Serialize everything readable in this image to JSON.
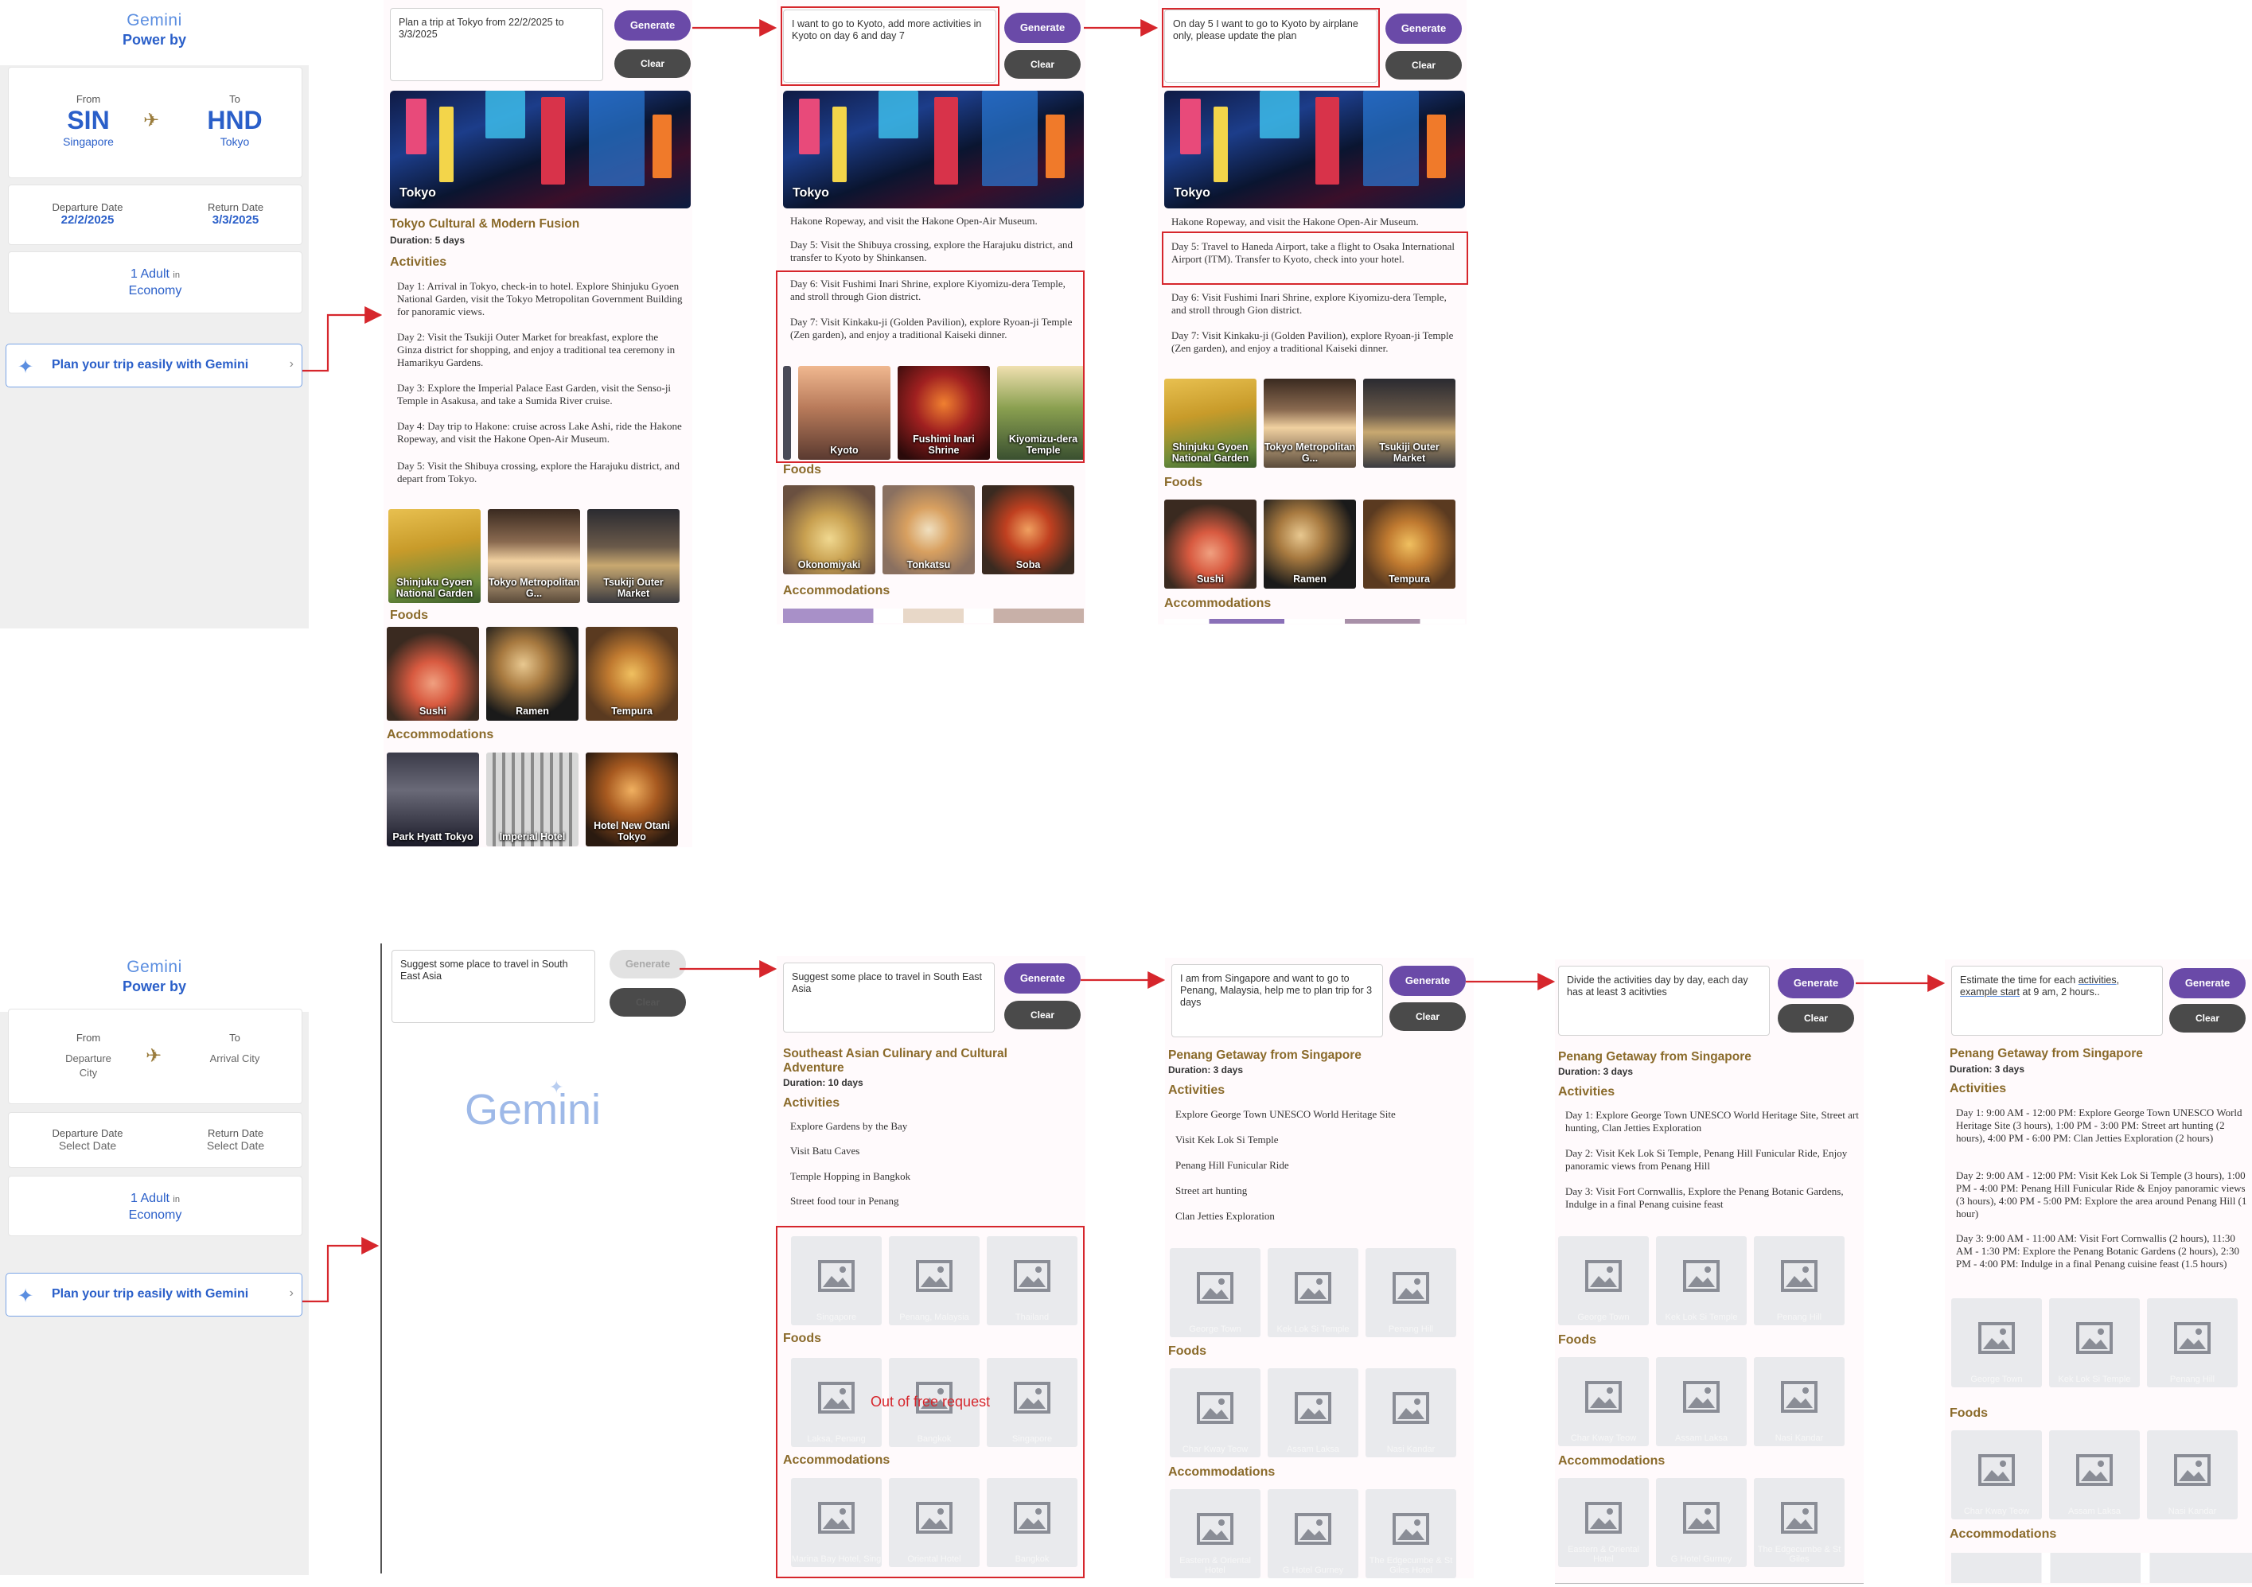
{
  "panel": {
    "logo": "Gemini",
    "powered": "Power by",
    "from_label": "From",
    "to_label": "To",
    "top": {
      "from_code": "SIN",
      "from_city": "Singapore",
      "to_code": "HND",
      "to_city": "Tokyo",
      "departure_label": "Departure Date",
      "departure_value": "22/2/2025",
      "return_label": "Return Date",
      "return_value": "3/3/2025"
    },
    "bottom": {
      "from_city": "Departure City",
      "to_city": "Arrival City",
      "departure_label": "Departure Date",
      "departure_value": "Select Date",
      "return_label": "Return Date",
      "return_value": "Select Date"
    },
    "pax_count": "1 Adult",
    "pax_in": "in",
    "pax_class": "Economy",
    "plan_label": "Plan your trip easily with Gemini",
    "chevron": "›"
  },
  "buttons": {
    "generate": "Generate",
    "clear": "Clear"
  },
  "icons": {
    "plane": "✈",
    "gemini": "✦"
  },
  "sections": {
    "activities": "Activities",
    "foods": "Foods",
    "accommodations": "Accommodations"
  },
  "top": {
    "s1": {
      "prompt": "Plan a trip at Tokyo from 22/2/2025 to 3/3/2025",
      "hero_caption": "Tokyo",
      "title": "Tokyo Cultural & Modern Fusion",
      "duration": "Duration: 5 days",
      "days": [
        "Day 1: Arrival in Tokyo, check-in to hotel. Explore Shinjuku Gyoen National Garden, visit the Tokyo Metropolitan Government Building for panoramic views.",
        "Day 2: Visit the Tsukiji Outer Market for breakfast, explore the Ginza district for shopping, and enjoy a traditional tea ceremony in Hamarikyu Gardens.",
        "Day 3: Explore the Imperial Palace East Garden, visit the Senso-ji Temple in Asakusa, and take a Sumida River cruise.",
        "Day 4: Day trip to Hakone: cruise across Lake Ashi, ride the Hakone Ropeway, and visit the Hakone Open-Air Museum.",
        "Day 5: Visit the Shibuya crossing, explore the Harajuku district, and depart from Tokyo."
      ],
      "activity_thumbs": [
        "Shinjuku Gyoen National Garden",
        "Tokyo Metropolitan G...",
        "Tsukiji Outer Market"
      ],
      "food_thumbs": [
        "Sushi",
        "Ramen",
        "Tempura"
      ],
      "accom_thumbs": [
        "Park Hyatt Tokyo",
        "Imperial Hotel",
        "Hotel New Otani Tokyo"
      ]
    },
    "s2": {
      "prompt": "I want to go to Kyoto, add more activities in Kyoto on day 6 and day 7",
      "hero_caption": "Tokyo",
      "day4_tail": "Hakone Ropeway, and visit the Hakone Open-Air Museum.",
      "day5": "Day 5: Visit the Shibuya crossing, explore the Harajuku district, and transfer to Kyoto by Shinkansen.",
      "day6": "Day 6: Visit Fushimi Inari Shrine, explore Kiyomizu-dera Temple, and stroll through Gion district.",
      "day7": "Day 7: Visit Kinkaku-ji (Golden Pavilion), explore Ryoan-ji Temple (Zen garden), and enjoy a traditional Kaiseki dinner.",
      "activity_thumbs": [
        "Kyoto",
        "Fushimi Inari Shrine",
        "Kiyomizu-dera Temple"
      ],
      "food_thumbs": [
        "Okonomiyaki",
        "Tonkatsu",
        "Soba"
      ]
    },
    "s3": {
      "prompt": "On day 5 I want to go to Kyoto by airplane only, please update the plan",
      "hero_caption": "Tokyo",
      "day4_tail": "Hakone Ropeway, and visit the Hakone Open-Air Museum.",
      "day5": "Day 5: Travel to Haneda Airport, take a flight to Osaka International Airport (ITM). Transfer to Kyoto, check into your hotel.",
      "day6": "Day 6: Visit Fushimi Inari Shrine, explore Kiyomizu-dera Temple, and stroll through Gion district.",
      "day7": "Day 7: Visit Kinkaku-ji (Golden Pavilion), explore Ryoan-ji Temple (Zen garden), and enjoy a traditional Kaiseki dinner.",
      "activity_thumbs": [
        "Shinjuku Gyoen National Garden",
        "Tokyo Metropolitan G...",
        "Tsukiji Outer Market"
      ],
      "food_thumbs": [
        "Sushi",
        "Ramen",
        "Tempura"
      ]
    }
  },
  "bottom": {
    "b1": {
      "prompt": "Suggest some place to travel in South East Asia",
      "wordmark": "Gemini"
    },
    "b2": {
      "prompt": "Suggest some place to travel in South East Asia",
      "title": "Southeast Asian Culinary and Cultural Adventure",
      "duration": "Duration: 10 days",
      "items": [
        "Explore Gardens by the Bay",
        "Visit Batu Caves",
        "Temple Hopping in Bangkok",
        "Street food tour in Penang"
      ],
      "activity_ph": [
        "Singapore",
        "Penang, Malaysia",
        "Thailand"
      ],
      "food_ph": [
        "Laksa, Penang",
        "Bangkok",
        "Singapore"
      ],
      "accom_ph": [
        "Marina Bay Hotel, Sing",
        "Oriental Hotel",
        "Bangkok"
      ],
      "error": "Out of free request"
    },
    "b3": {
      "prompt": "I am from Singapore and want to go to Penang, Malaysia, help me to plan trip for 3 days",
      "title": "Penang Getaway from Singapore",
      "duration": "Duration: 3 days",
      "items": [
        "Explore George Town UNESCO World Heritage Site",
        "Visit Kek Lok Si Temple",
        "Penang Hill Funicular Ride",
        "Street art hunting",
        "Clan Jetties Exploration"
      ],
      "activity_ph": [
        "George Town",
        "Kek Lok Si Temple",
        "Penang Hill"
      ],
      "food_ph": [
        "Char Kway Teow",
        "Assam Laksa",
        "Nasi Kandar"
      ],
      "accom_ph": [
        "Eastern & Oriental Hotel",
        "G Hotel Gurney",
        "The Edgecumbe & St Giles Hotel"
      ]
    },
    "b4": {
      "prompt": "Divide the activities day by day, each day has at least 3 acitivties",
      "title": "Penang Getaway from Singapore",
      "duration": "Duration: 3 days",
      "days": [
        "Day 1: Explore George Town UNESCO World Heritage Site, Street art hunting, Clan Jetties Exploration",
        "Day 2: Visit Kek Lok Si Temple, Penang Hill Funicular Ride, Enjoy panoramic views from Penang Hill",
        "Day 3: Visit Fort Cornwallis, Explore the Penang Botanic Gardens, Indulge in a final Penang cuisine feast"
      ],
      "activity_ph": [
        "George Town",
        "Kek Lok Si Temple",
        "Penang Hill"
      ],
      "food_ph": [
        "Char Kway Teow",
        "Assam Laksa",
        "Nasi Kandar"
      ],
      "accom_ph": [
        "Eastern & Oriental Hotel",
        "G Hotel Gurney",
        "The Edgecumbe & St Giles"
      ]
    },
    "b5": {
      "prompt_a": "Estimate the time for each ",
      "prompt_b": "activities",
      "prompt_c": ", ",
      "prompt_d": "example start",
      "prompt_e": " at 9 am, 2 hours..",
      "title": "Penang Getaway from Singapore",
      "duration": "Duration: 3 days",
      "days": [
        "Day 1: 9:00 AM - 12:00 PM: Explore George Town UNESCO World Heritage Site (3 hours), 1:00 PM - 3:00 PM: Street art hunting (2 hours), 4:00 PM - 6:00 PM: Clan Jetties Exploration (2 hours)",
        "Day 2: 9:00 AM - 12:00 PM: Visit Kek Lok Si Temple (3 hours), 1:00 PM - 4:00 PM: Penang Hill Funicular Ride & Enjoy panoramic views (3 hours), 4:00 PM - 5:00 PM: Explore the area around Penang Hill (1 hour)",
        "Day 3: 9:00 AM - 11:00 AM: Visit Fort Cornwallis (2 hours), 11:30 AM - 1:30 PM: Explore the Penang Botanic Gardens (2 hours), 2:30 PM - 4:00 PM: Indulge in a final Penang cuisine feast (1.5 hours)"
      ],
      "activity_ph": [
        "George Town",
        "Kek Lok Si Temple",
        "Penang Hill"
      ],
      "food_ph": [
        "Char Kway Teow",
        "Assam Laksa",
        "Nasi Kandar"
      ]
    }
  }
}
